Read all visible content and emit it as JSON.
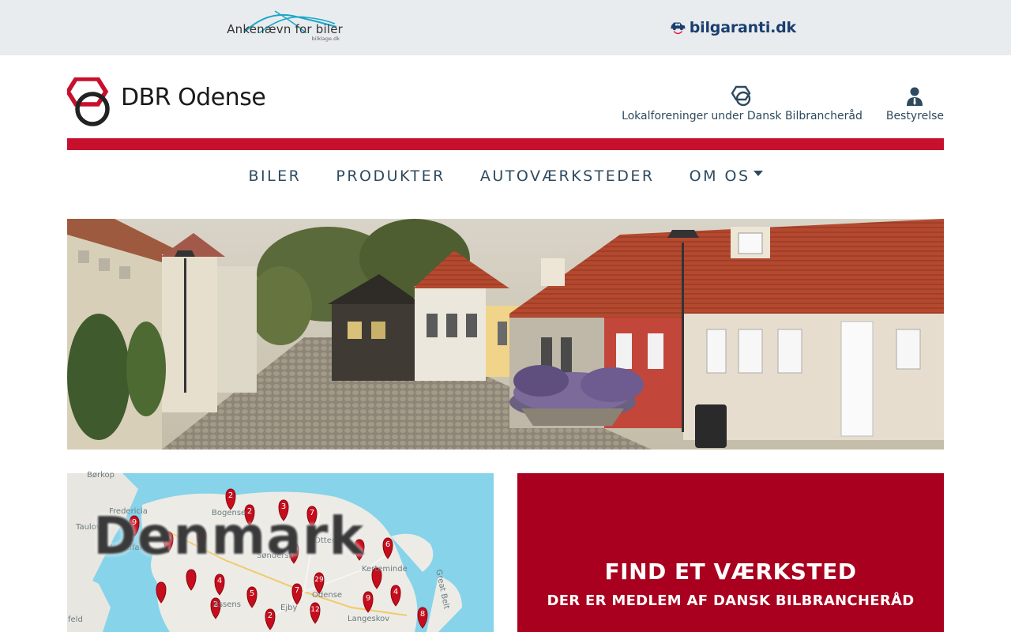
{
  "partners": {
    "ankenaevn": {
      "name": "Ankenævn for biler",
      "sub": "bilklage.dk"
    },
    "bilgaranti": {
      "name": "bilgaranti.dk"
    }
  },
  "header": {
    "logo_text": "DBR Odense",
    "links": [
      {
        "label": "Lokalforeninger under Dansk Bilbrancheråd",
        "icon": "linked-rings-icon"
      },
      {
        "label": "Bestyrelse",
        "icon": "person-icon"
      }
    ]
  },
  "nav": {
    "items": [
      {
        "label": "BILER"
      },
      {
        "label": "PRODUKTER"
      },
      {
        "label": "AUTOVÆRKSTEDER"
      },
      {
        "label": "OM OS",
        "dropdown": true
      }
    ]
  },
  "map": {
    "country_label": "Denmark",
    "place_labels": [
      "Børkop",
      "Fredericia",
      "Middelfart",
      "Bogense",
      "Søndersø",
      "Otterup",
      "Kerteminde",
      "Assens",
      "Odense",
      "Langeskov",
      "Great Belt",
      "feld",
      "Taulov",
      "Ejby"
    ],
    "markers": [
      {
        "label": "2"
      },
      {
        "label": "9"
      },
      {
        "label": "2"
      },
      {
        "label": "3"
      },
      {
        "label": "7"
      },
      {
        "label": "9"
      },
      {
        "label": "4"
      },
      {
        "label": ""
      },
      {
        "label": "6"
      },
      {
        "label": "19"
      },
      {
        "label": ""
      },
      {
        "label": "4"
      },
      {
        "label": "29"
      },
      {
        "label": ""
      },
      {
        "label": ""
      },
      {
        "label": "5"
      },
      {
        "label": "7"
      },
      {
        "label": "9"
      },
      {
        "label": "4"
      },
      {
        "label": "2"
      },
      {
        "label": "2"
      },
      {
        "label": "12"
      },
      {
        "label": "8"
      }
    ]
  },
  "find": {
    "title": "FIND ET VÆRKSTED",
    "subtitle": "DER ER MEDLEM AF DANSK BILBRANCHERÅD"
  },
  "colors": {
    "brand_red": "#c8102e",
    "card_red": "#a8001e",
    "nav_text": "#2e4a5e",
    "partner_bg": "#e9ecef"
  }
}
